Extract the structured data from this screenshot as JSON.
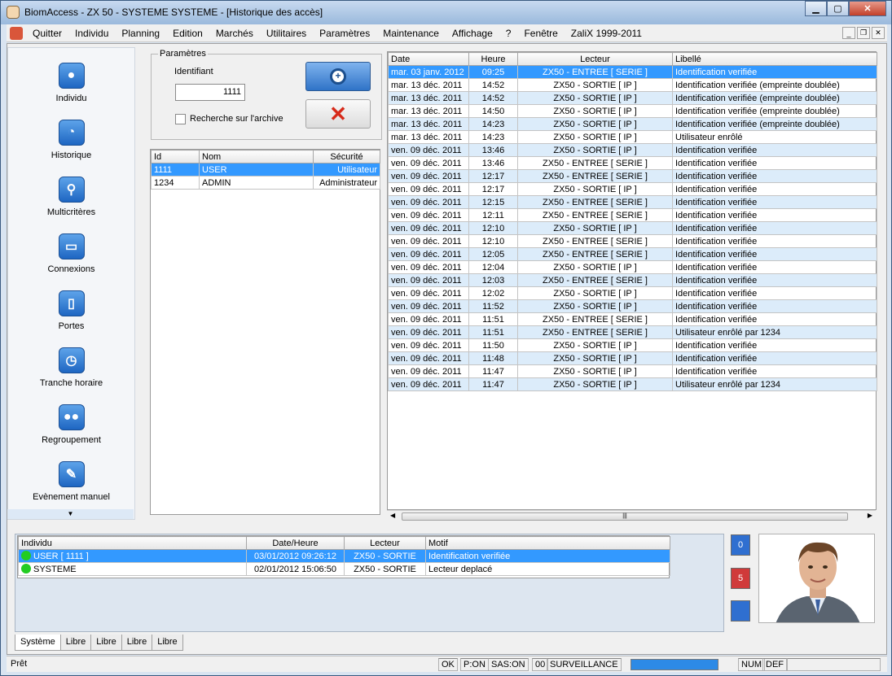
{
  "window": {
    "title": "BiomAccess - ZX 50 - SYSTEME SYSTEME - [Historique des accès]"
  },
  "menu": [
    "Quitter",
    "Individu",
    "Planning",
    "Edition",
    "Marchés",
    "Utilitaires",
    "Paramètres",
    "Maintenance",
    "Affichage",
    "?",
    "Fenêtre",
    "ZaliX 1999-2011"
  ],
  "nav": [
    {
      "label": "Individu",
      "icon": "person-icon"
    },
    {
      "label": "Historique",
      "icon": "history-icon"
    },
    {
      "label": "Multicritères",
      "icon": "search-icon"
    },
    {
      "label": "Connexions",
      "icon": "monitor-icon"
    },
    {
      "label": "Portes",
      "icon": "door-icon"
    },
    {
      "label": "Tranche horaire",
      "icon": "clock-icon"
    },
    {
      "label": "Regroupement",
      "icon": "group-icon"
    },
    {
      "label": "Evènement manuel",
      "icon": "pencil-icon"
    }
  ],
  "params": {
    "legend": "Paramètres",
    "id_label": "Identifiant",
    "id_value": "1111",
    "archive_label": "Recherche sur l'archive"
  },
  "users": {
    "headers": [
      "Id",
      "Nom",
      "Sécurité"
    ],
    "rows": [
      [
        "1111",
        "USER",
        "Utilisateur"
      ],
      [
        "1234",
        "ADMIN",
        "Administrateur"
      ]
    ]
  },
  "history": {
    "headers": [
      "Date",
      "Heure",
      "Lecteur",
      "Libellé"
    ],
    "rows": [
      [
        "mar. 03 janv. 2012",
        "09:25",
        "ZX50 - ENTREE [ SERIE ]",
        "Identification verifiée"
      ],
      [
        "mar. 13 déc. 2011",
        "14:52",
        "ZX50 - SORTIE [ IP ]",
        "Identification verifiée (empreinte doublée)"
      ],
      [
        "mar. 13 déc. 2011",
        "14:52",
        "ZX50 - SORTIE [ IP ]",
        "Identification verifiée (empreinte doublée)"
      ],
      [
        "mar. 13 déc. 2011",
        "14:50",
        "ZX50 - SORTIE [ IP ]",
        "Identification verifiée (empreinte doublée)"
      ],
      [
        "mar. 13 déc. 2011",
        "14:23",
        "ZX50 - SORTIE [ IP ]",
        "Identification verifiée (empreinte doublée)"
      ],
      [
        "mar. 13 déc. 2011",
        "14:23",
        "ZX50 - SORTIE [ IP ]",
        "Utilisateur enrôlé"
      ],
      [
        "ven. 09 déc. 2011",
        "13:46",
        "ZX50 - SORTIE [ IP ]",
        "Identification verifiée"
      ],
      [
        "ven. 09 déc. 2011",
        "13:46",
        "ZX50 - ENTREE [ SERIE ]",
        "Identification verifiée"
      ],
      [
        "ven. 09 déc. 2011",
        "12:17",
        "ZX50 - ENTREE [ SERIE ]",
        "Identification verifiée"
      ],
      [
        "ven. 09 déc. 2011",
        "12:17",
        "ZX50 - SORTIE [ IP ]",
        "Identification verifiée"
      ],
      [
        "ven. 09 déc. 2011",
        "12:15",
        "ZX50 - ENTREE [ SERIE ]",
        "Identification verifiée"
      ],
      [
        "ven. 09 déc. 2011",
        "12:11",
        "ZX50 - ENTREE [ SERIE ]",
        "Identification verifiée"
      ],
      [
        "ven. 09 déc. 2011",
        "12:10",
        "ZX50 - SORTIE [ IP ]",
        "Identification verifiée"
      ],
      [
        "ven. 09 déc. 2011",
        "12:10",
        "ZX50 - ENTREE [ SERIE ]",
        "Identification verifiée"
      ],
      [
        "ven. 09 déc. 2011",
        "12:05",
        "ZX50 - ENTREE [ SERIE ]",
        "Identification verifiée"
      ],
      [
        "ven. 09 déc. 2011",
        "12:04",
        "ZX50 - SORTIE [ IP ]",
        "Identification verifiée"
      ],
      [
        "ven. 09 déc. 2011",
        "12:03",
        "ZX50 - ENTREE [ SERIE ]",
        "Identification verifiée"
      ],
      [
        "ven. 09 déc. 2011",
        "12:02",
        "ZX50 - SORTIE [ IP ]",
        "Identification verifiée"
      ],
      [
        "ven. 09 déc. 2011",
        "11:52",
        "ZX50 - SORTIE [ IP ]",
        "Identification verifiée"
      ],
      [
        "ven. 09 déc. 2011",
        "11:51",
        "ZX50 - ENTREE [ SERIE ]",
        "Identification verifiée"
      ],
      [
        "ven. 09 déc. 2011",
        "11:51",
        "ZX50 - ENTREE [ SERIE ]",
        "Utilisateur enrôlé par 1234"
      ],
      [
        "ven. 09 déc. 2011",
        "11:50",
        "ZX50 - SORTIE [ IP ]",
        "Identification verifiée"
      ],
      [
        "ven. 09 déc. 2011",
        "11:48",
        "ZX50 - SORTIE [ IP ]",
        "Identification verifiée"
      ],
      [
        "ven. 09 déc. 2011",
        "11:47",
        "ZX50 - SORTIE [ IP ]",
        "Identification verifiée"
      ],
      [
        "ven. 09 déc. 2011",
        "11:47",
        "ZX50 - SORTIE [ IP ]",
        "Utilisateur enrôlé par 1234"
      ]
    ]
  },
  "events": {
    "headers": [
      "Individu",
      "Date/Heure",
      "Lecteur",
      "Motif"
    ],
    "rows": [
      [
        "USER   [ 1111 ]",
        "03/01/2012 09:26:12",
        "ZX50 - SORTIE",
        "Identification verifiée"
      ],
      [
        "SYSTEME",
        "02/01/2012 15:06:50",
        "ZX50 - SORTIE",
        "Lecteur deplacé"
      ]
    ]
  },
  "side_buttons": [
    {
      "label": "0",
      "color": "#2f6fd0"
    },
    {
      "label": "5",
      "color": "#d03a3a"
    },
    {
      "label": "",
      "color": "#2f6fd0"
    }
  ],
  "tabs": [
    "Système",
    "Libre",
    "Libre",
    "Libre",
    "Libre"
  ],
  "status": {
    "left": "Prêt",
    "ok": "OK",
    "pon": "P:ON",
    "sason": "SAS:ON",
    "code": "00",
    "mode": "SURVEILLANCE",
    "num": "NUM",
    "def": "DEF"
  },
  "colors": {
    "selection": "#3399ff",
    "alt_row": "#dcecfa",
    "green_dot": "#22cc22"
  }
}
